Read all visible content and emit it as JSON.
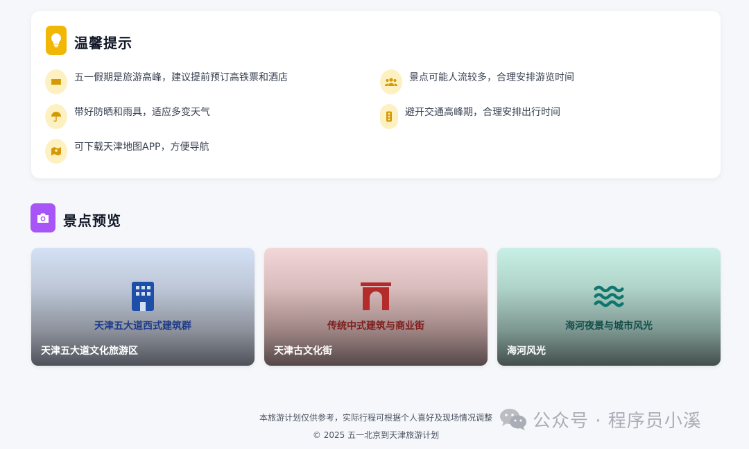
{
  "tips": {
    "title": "温馨提示",
    "icon": "lightbulb-icon",
    "items": [
      {
        "text": "五一假期是旅游高峰，建议提前预订高铁票和酒店",
        "icon": "ticket-icon"
      },
      {
        "text": "景点可能人流较多，合理安排游览时间",
        "icon": "people-icon"
      },
      {
        "text": "带好防晒和雨具，适应多变天气",
        "icon": "umbrella-icon"
      },
      {
        "text": "避开交通高峰期，合理安排出行时间",
        "icon": "traffic-light-icon"
      },
      {
        "text": "可下载天津地图APP，方便导航",
        "icon": "map-icon"
      }
    ]
  },
  "preview": {
    "title": "景点预览",
    "icon": "camera-icon",
    "cards": [
      {
        "caption": "天津五大道西式建筑群",
        "name": "天津五大道文化旅游区",
        "icon": "building-icon",
        "accent": "#1e4fa8"
      },
      {
        "caption": "传统中式建筑与商业街",
        "name": "天津古文化街",
        "icon": "torii-gate-icon",
        "accent": "#b32b2b"
      },
      {
        "caption": "海河夜景与城市风光",
        "name": "海河风光",
        "icon": "water-waves-icon",
        "accent": "#0f766e"
      }
    ]
  },
  "footer": {
    "note": "本旅游计划仅供参考，实际行程可根据个人喜好及现场情况调整",
    "copyright": "© 2025 五一北京到天津旅游计划"
  },
  "watermark": {
    "text": "公众号 · 程序员小溪",
    "icon": "wechat-icon"
  },
  "colors": {
    "tips_accent": "#f2b705",
    "tip_icon_bg": "#fdf1c2",
    "preview_accent": "#a855f7",
    "page_bg": "#f6f7fa"
  }
}
